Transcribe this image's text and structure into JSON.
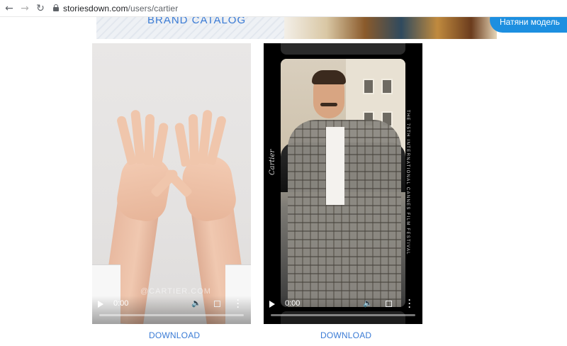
{
  "browser": {
    "url_host": "storiesdown.com",
    "url_path": "/users/cartier",
    "back_icon": "arrow-left-icon",
    "forward_icon": "arrow-right-icon",
    "reload_icon": "reload-icon",
    "lock_icon": "lock-icon"
  },
  "banner": {
    "title": "BRAND CATALOG",
    "pill_text": "Натяни модель",
    "accent": "#3a7bd5",
    "pill_color": "#1d8fe0"
  },
  "videos": [
    {
      "time": "0:00",
      "watermark": "@CARTIER.COM",
      "download_label": "DOWNLOAD"
    },
    {
      "time": "0:00",
      "brand_text": "Cartier",
      "festival_text": "THE 75TH INTERNATIONAL CANNES FILM FESTIVAL",
      "download_label": "DOWNLOAD"
    }
  ],
  "controls": {
    "play_icon": "play-icon",
    "volume_icon": "volume-icon",
    "fullscreen_icon": "fullscreen-icon",
    "more_icon": "more-vertical-icon",
    "progress": 0
  }
}
